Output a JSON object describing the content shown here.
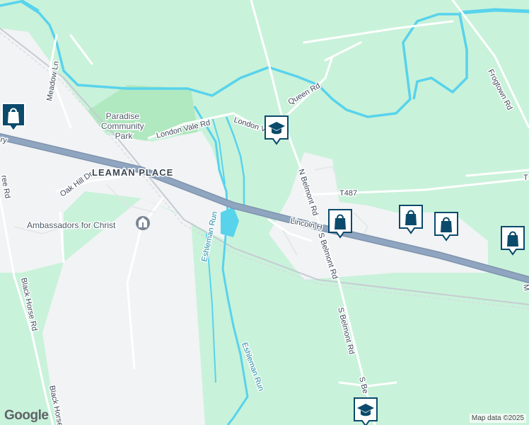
{
  "map": {
    "places": {
      "park": "Paradise\nCommunity\nPark",
      "leaman_place": "LEAMAN PLACE",
      "ambassadors": "Ambassadors for Christ"
    },
    "roads": {
      "meadow_ln": "Meadow Ln",
      "london_vale_rd": "London Vale Rd",
      "london_vale_short": "London V",
      "queen_rd": "Queen Rd",
      "frogtown_rd": "Frogtown Rd",
      "n_belmont_rd": "N Belmont Rd",
      "s_belmont_rd_1": "S Belmont Rd",
      "s_belmont_rd_2": "S Belmont Rd",
      "s_belmont_rd_3": "S Be",
      "t487": "T487",
      "t_partial": "T",
      "lincoln_hwy": "Lincoln H",
      "lincoln_hwy_west": "ry",
      "oak_hill_dr": "Oak Hill Dr",
      "black_horse_rd_1": "Black Horse Rd",
      "black_horse_rd_2": "Black Horse",
      "lower_left_partial": "ree Rd",
      "right_edge_partial": "M"
    },
    "waterways": {
      "eshleman_run_1": "Eshleman Run",
      "eshleman_run_2": "Eshleman Run"
    },
    "markers": [
      {
        "name": "shopping-marker",
        "icon": "shopping-bag-icon"
      },
      {
        "name": "school-marker",
        "icon": "school-icon"
      },
      {
        "name": "shopping-marker",
        "icon": "shopping-bag-icon"
      },
      {
        "name": "shopping-marker",
        "icon": "shopping-bag-icon"
      },
      {
        "name": "shopping-marker",
        "icon": "shopping-bag-icon"
      },
      {
        "name": "shopping-marker",
        "icon": "shopping-bag-icon"
      },
      {
        "name": "school-marker",
        "icon": "school-icon"
      }
    ],
    "colors": {
      "land": "#c9f2da",
      "urban": "#f1f3f4",
      "highway": "#8fa5c0",
      "water": "#58d3ec",
      "marker": "#0b4a6b"
    }
  },
  "attribution": {
    "logo": "Google",
    "text": "Map data ©2025"
  }
}
